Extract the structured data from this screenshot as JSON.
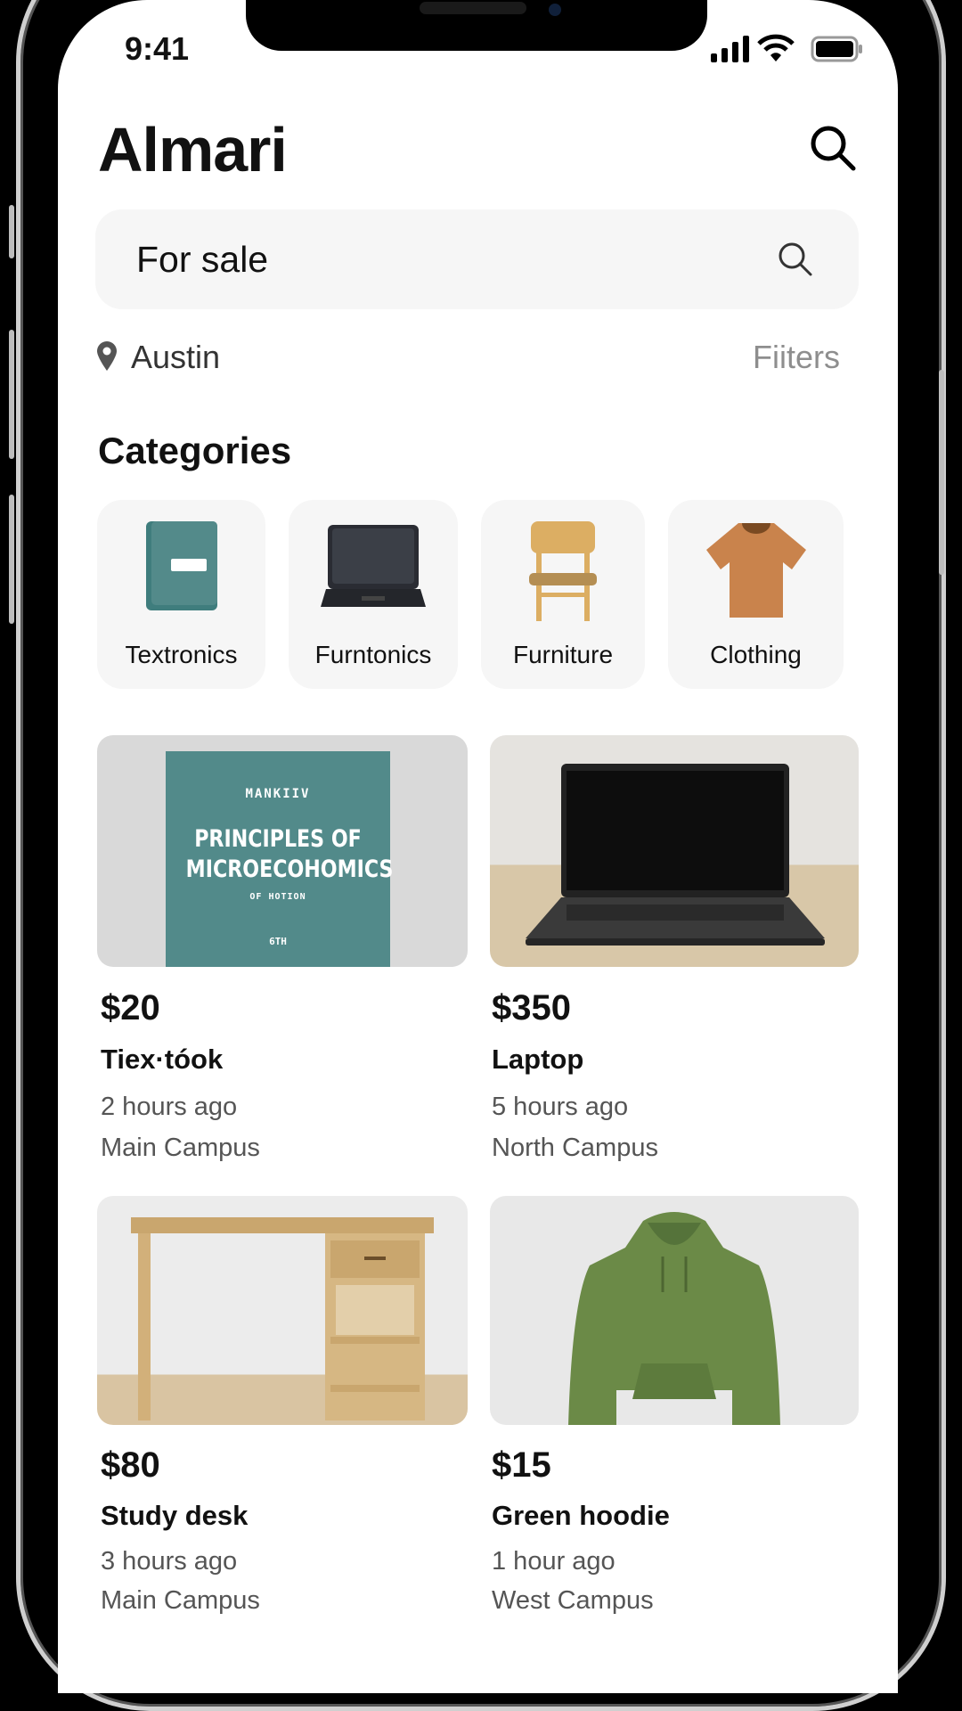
{
  "status": {
    "time": "9:41"
  },
  "header": {
    "title": "Almari"
  },
  "search": {
    "value": "For sale"
  },
  "location": {
    "city": "Austin",
    "filters_label": "Fiiters"
  },
  "categories": {
    "heading": "Categories",
    "items": [
      {
        "label": "Textronics"
      },
      {
        "label": "Furntonics"
      },
      {
        "label": "Furniture"
      },
      {
        "label": "Clothing"
      }
    ]
  },
  "book_cover": {
    "author": "MANKIIV",
    "title1": "PRINCIPLES OF",
    "title2": "MICROECOHOMICS",
    "subtitle": "OF HOTION",
    "edition": "6TH"
  },
  "listings": [
    {
      "price": "$20",
      "title": "Tiex·tóok",
      "time": "2 hours ago",
      "location": "Main Campus"
    },
    {
      "price": "$350",
      "title": "Laptop",
      "time": "5 hours ago",
      "location": "North Campus"
    },
    {
      "price": "$80",
      "title": "Study desk",
      "time": "3 hours ago",
      "location": "Main Campus"
    },
    {
      "price": "$15",
      "title": "Green hoodie",
      "time": "1 hour ago",
      "location": "West Campus"
    }
  ]
}
